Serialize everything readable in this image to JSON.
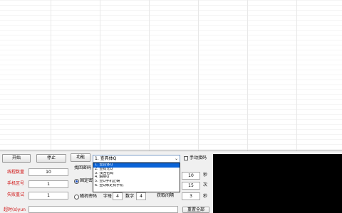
{
  "buttons": {
    "start": "开始",
    "stop": "停止",
    "function": "功能",
    "fetch_all": "重置全部"
  },
  "dropdown": {
    "selected": "1. 查具体Q",
    "options": [
      "1. 查具体Q",
      "2. 查有无Q",
      "3. 找回密码",
      "4. 解绑Q",
      "5. 查Q手机正确",
      "6. 查Q绑定有手机"
    ]
  },
  "manual_captcha": "手动接码",
  "fields": {
    "thread_count_label": "线程数量",
    "thread_count_value": "10",
    "phone_area_label": "手机区号",
    "phone_area_value": "1",
    "fail_retry_label": "失败重试",
    "fail_retry_value": "1",
    "timeout_label": "超时(s)yun",
    "retrieve_password_label": "找回密码",
    "fixed_password_label": "固定密",
    "random_password_label": "随机密码",
    "letters_label": "字母",
    "letters_value": "4",
    "digits_label": "数字",
    "digits_value": "4",
    "fetch_interval_label": "获取间隔",
    "fetch_interval_value": "3",
    "right_value_1": "10",
    "right_value_2": "15",
    "unit_seconds_1": "秒",
    "unit_times": "次",
    "unit_seconds_2": "秒"
  }
}
